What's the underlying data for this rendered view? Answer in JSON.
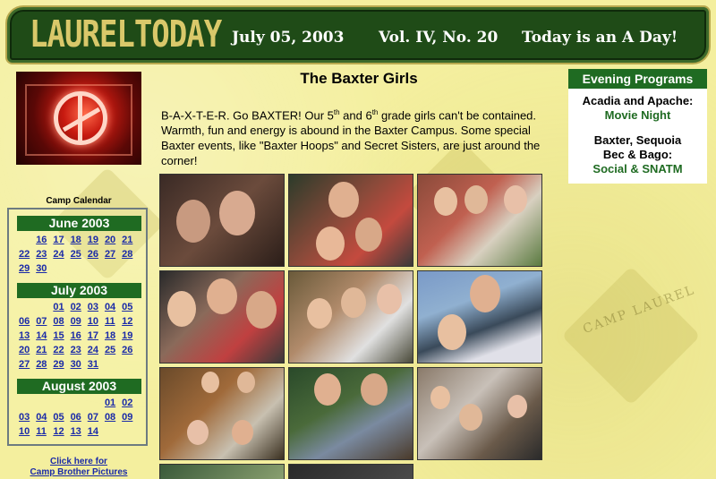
{
  "header": {
    "logo": "LAURELTODAY",
    "date": "July 05, 2003",
    "volume": "Vol. IV, No. 20",
    "day_type": "Today is an A Day!"
  },
  "page": {
    "title": "The Baxter Girls",
    "intro_a": "B-A-X-T-E-R. Go BAXTER! Our 5",
    "intro_sup1": "th",
    "intro_b": " and 6",
    "intro_sup2": "th",
    "intro_c": " grade girls can't be contained. Warmth, fun and energy is abound in the Baxter Campus. Some special Baxter events, like \"Baxter Hoops\" and Secret Sisters, are just around the corner!"
  },
  "calendar": {
    "title": "Camp Calendar",
    "months": [
      {
        "name": "June 2003",
        "weeks": [
          [
            "",
            "16",
            "17",
            "18",
            "19",
            "20",
            "21"
          ],
          [
            "22",
            "23",
            "24",
            "25",
            "26",
            "27",
            "28"
          ],
          [
            "29",
            "30",
            "",
            "",
            "",
            "",
            ""
          ]
        ]
      },
      {
        "name": "July 2003",
        "weeks": [
          [
            "",
            "",
            "01",
            "02",
            "03",
            "04",
            "05"
          ],
          [
            "06",
            "07",
            "08",
            "09",
            "10",
            "11",
            "12"
          ],
          [
            "13",
            "14",
            "15",
            "16",
            "17",
            "18",
            "19"
          ],
          [
            "20",
            "21",
            "22",
            "23",
            "24",
            "25",
            "26"
          ],
          [
            "27",
            "28",
            "29",
            "30",
            "31",
            "",
            ""
          ]
        ]
      },
      {
        "name": "August 2003",
        "weeks": [
          [
            "",
            "",
            "",
            "",
            "",
            "01",
            "02"
          ],
          [
            "03",
            "04",
            "05",
            "06",
            "07",
            "08",
            "09"
          ],
          [
            "10",
            "11",
            "12",
            "13",
            "14",
            "",
            ""
          ]
        ]
      }
    ]
  },
  "links": {
    "brother_line1": "Click here for",
    "brother_line2": "Camp Brother Pictures"
  },
  "evening": {
    "title": "Evening Programs",
    "items": [
      {
        "label": "Acadia and Apache:",
        "value": "Movie Night"
      },
      {
        "label": "Baxter, Sequoia Bec & Bago:",
        "value": "Social & SNATM"
      }
    ]
  },
  "watermark": "CAMP LAUREL",
  "colors": {
    "header_green": "#1f4b17",
    "accent_green": "#1f6b22",
    "link_blue": "#1a2aa8",
    "background": "#f4ef9e"
  }
}
